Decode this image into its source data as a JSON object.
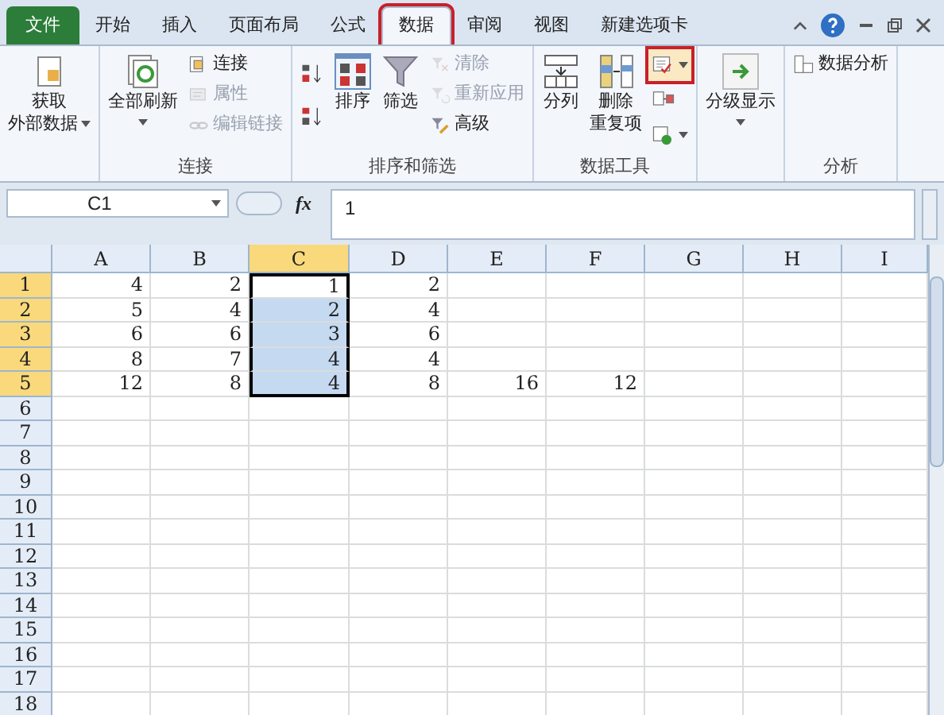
{
  "tabs": [
    {
      "label": "文件",
      "kind": "file",
      "selected": false,
      "marked": false
    },
    {
      "label": "开始",
      "kind": "tab",
      "selected": false,
      "marked": false
    },
    {
      "label": "插入",
      "kind": "tab",
      "selected": false,
      "marked": false
    },
    {
      "label": "页面布局",
      "kind": "tab",
      "selected": false,
      "marked": false
    },
    {
      "label": "公式",
      "kind": "tab",
      "selected": false,
      "marked": false
    },
    {
      "label": "数据",
      "kind": "tab",
      "selected": true,
      "marked": true
    },
    {
      "label": "审阅",
      "kind": "tab",
      "selected": false,
      "marked": false
    },
    {
      "label": "视图",
      "kind": "tab",
      "selected": false,
      "marked": false
    },
    {
      "label": "新建选项卡",
      "kind": "tab",
      "selected": false,
      "marked": false
    }
  ],
  "ribbon": [
    {
      "items": [
        {
          "kind": "large",
          "lines": [
            "获取",
            "外部数据"
          ],
          "dropdown": true,
          "disabled": false
        }
      ]
    },
    {
      "label": "连接",
      "items": [
        {
          "kind": "large",
          "lines": [
            "全部刷新"
          ],
          "dropdown": true,
          "disabled": false
        },
        {
          "kind": "small",
          "label": "连接",
          "disabled": false
        },
        {
          "kind": "small",
          "label": "属性",
          "disabled": true
        },
        {
          "kind": "small",
          "label": "编辑链接",
          "disabled": true
        }
      ]
    },
    {
      "label": "排序和筛选",
      "items": [
        {
          "kind": "pair"
        },
        {
          "kind": "large",
          "lines": [
            "排序"
          ],
          "dropdown": false,
          "disabled": false
        },
        {
          "kind": "large",
          "lines": [
            "筛选"
          ],
          "dropdown": false,
          "disabled": false
        },
        {
          "kind": "small",
          "label": "清除",
          "disabled": true
        },
        {
          "kind": "small",
          "label": "重新应用",
          "disabled": true
        },
        {
          "kind": "small",
          "label": "高级",
          "disabled": false
        }
      ]
    },
    {
      "label": "数据工具",
      "items": [
        {
          "kind": "large",
          "lines": [
            "分列"
          ],
          "dropdown": false,
          "disabled": false
        },
        {
          "kind": "large",
          "lines": [
            "删除",
            "重复项"
          ],
          "dropdown": false,
          "disabled": false
        },
        {
          "kind": "iconstack",
          "buttons": [
            {
              "dropdown": true,
              "marked": true
            },
            {
              "dropdown": false,
              "marked": false
            },
            {
              "dropdown": true,
              "marked": false
            }
          ]
        }
      ]
    },
    {
      "items": [
        {
          "kind": "large",
          "lines": [
            "分级显示"
          ],
          "dropdown": true,
          "disabled": false
        }
      ]
    },
    {
      "label": "分析",
      "items": [
        {
          "kind": "small",
          "label": "数据分析",
          "disabled": false
        }
      ]
    }
  ],
  "name_box": "C1",
  "function_label": "fx",
  "formula": "1",
  "columns": [
    {
      "label": "A",
      "selected": false
    },
    {
      "label": "B",
      "selected": false
    },
    {
      "label": "C",
      "selected": true
    },
    {
      "label": "D",
      "selected": false
    },
    {
      "label": "E",
      "selected": false
    },
    {
      "label": "F",
      "selected": false
    },
    {
      "label": "G",
      "selected": false
    },
    {
      "label": "H",
      "selected": false
    },
    {
      "label": "I",
      "selected": false
    }
  ],
  "rows": [
    {
      "label": "1",
      "selected": true,
      "cells": [
        "4",
        "2",
        "1",
        "2",
        null,
        null,
        null,
        null,
        null
      ]
    },
    {
      "label": "2",
      "selected": true,
      "cells": [
        "5",
        "4",
        "2",
        "4",
        null,
        null,
        null,
        null,
        null
      ]
    },
    {
      "label": "3",
      "selected": true,
      "cells": [
        "6",
        "6",
        "3",
        "6",
        null,
        null,
        null,
        null,
        null
      ]
    },
    {
      "label": "4",
      "selected": true,
      "cells": [
        "8",
        "7",
        "4",
        "4",
        null,
        null,
        null,
        null,
        null
      ]
    },
    {
      "label": "5",
      "selected": true,
      "cells": [
        "12",
        "8",
        "4",
        "8",
        "16",
        "12",
        null,
        null,
        null
      ]
    },
    {
      "label": "6",
      "selected": false,
      "cells": []
    },
    {
      "label": "7",
      "selected": false,
      "cells": []
    },
    {
      "label": "8",
      "selected": false,
      "cells": []
    },
    {
      "label": "9",
      "selected": false,
      "cells": []
    },
    {
      "label": "10",
      "selected": false,
      "cells": []
    },
    {
      "label": "11",
      "selected": false,
      "cells": []
    },
    {
      "label": "12",
      "selected": false,
      "cells": []
    },
    {
      "label": "13",
      "selected": false,
      "cells": []
    },
    {
      "label": "14",
      "selected": false,
      "cells": []
    },
    {
      "label": "15",
      "selected": false,
      "cells": []
    },
    {
      "label": "16",
      "selected": false,
      "cells": []
    },
    {
      "label": "17",
      "selected": false,
      "cells": []
    },
    {
      "label": "18",
      "selected": false,
      "cells": []
    }
  ]
}
